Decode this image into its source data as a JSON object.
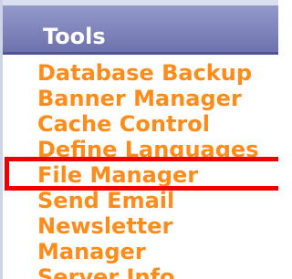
{
  "header": {
    "title": "Tools"
  },
  "menu": {
    "items": [
      {
        "label": "Database Backup"
      },
      {
        "label": "Banner Manager"
      },
      {
        "label": "Cache Control"
      },
      {
        "label": "Define Languages"
      },
      {
        "label": "File Manager"
      },
      {
        "label": "Send Email"
      },
      {
        "label": "Newsletter"
      },
      {
        "label": "Manager"
      },
      {
        "label": "Server Info"
      }
    ]
  },
  "colors": {
    "header_bg": "#7e83bd",
    "link": "#ff8c1a",
    "highlight": "#ee0000"
  }
}
